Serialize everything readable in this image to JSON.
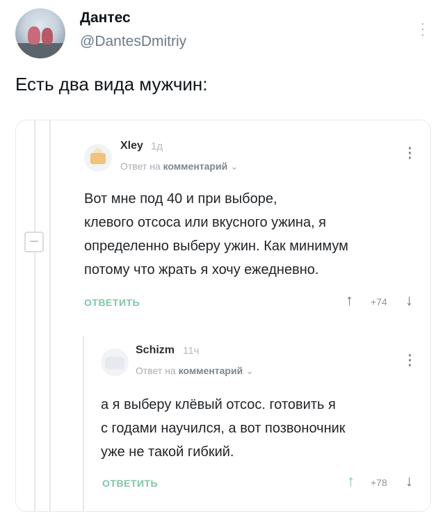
{
  "tweet": {
    "author_name": "Дантес",
    "author_handle": "@DantesDmitriy",
    "text": "Есть два вида мужчин:"
  },
  "comments": [
    {
      "username": "Xley",
      "time": "1д",
      "reply_prefix": "Ответ на",
      "reply_target": "комментарий",
      "lines": [
        "Вот мне под 40 и при выборе,",
        "клевого отсоса или вкусного ужина, я",
        "определенно выберу ужин. Как минимум",
        "потому что жрать я хочу ежедневно."
      ],
      "reply_label": "ОТВЕТИТЬ",
      "rating": "+74"
    },
    {
      "username": "Schizm",
      "time": "11ч",
      "reply_prefix": "Ответ на",
      "reply_target": "комментарий",
      "lines": [
        "а я выберу клёвый отсос. готовить я",
        "с годами научился, а вот позвоночник",
        "уже не такой гибкий."
      ],
      "reply_label": "ОТВЕТИТЬ",
      "rating": "+78"
    }
  ],
  "icons": {
    "tweet_more": "more-vertical-icon",
    "comment_menu": "kebab-menu-icon",
    "upvote": "arrow-up-icon",
    "downvote": "arrow-down-icon",
    "collapse": "collapse-minus-icon",
    "dropdown": "chevron-down-icon"
  },
  "colors": {
    "reply_accent": "#7ec7a4",
    "handle_gray": "#6c7a86"
  }
}
